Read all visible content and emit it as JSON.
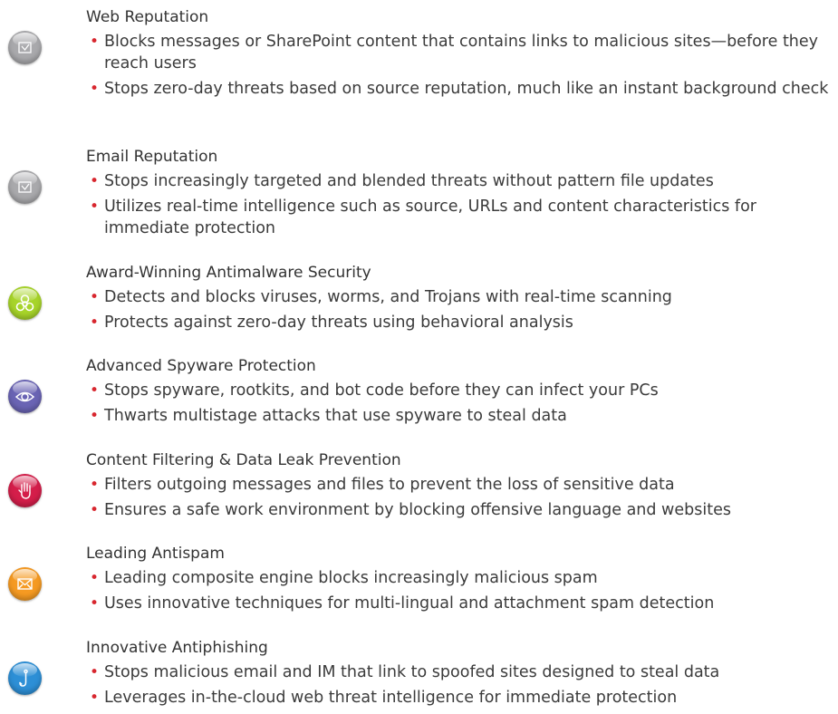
{
  "features": [
    {
      "title": "Web Reputation",
      "icon": "envelope-check-icon",
      "color": "#a9a9ac",
      "bullets": [
        "Blocks messages or SharePoint content that contains links to malicious sites—before they reach users",
        "Stops zero-day threats based on source reputation, much like an instant background check"
      ]
    },
    {
      "title": "Email Reputation",
      "icon": "envelope-check-icon",
      "color": "#a9a9ac",
      "bullets": [
        "Stops increasingly targeted and blended threats without pattern file updates",
        "Utilizes real-time intelligence such as source, URLs and content characteristics for immediate protection"
      ]
    },
    {
      "title": "Award-Winning Antimalware Security",
      "icon": "biohazard-icon",
      "color": "#a7d42a",
      "bullets": [
        "Detects and blocks viruses, worms, and Trojans with real-time scanning",
        "Protects against zero-day threats using behavioral analysis"
      ]
    },
    {
      "title": "Advanced Spyware Protection",
      "icon": "eye-icon",
      "color": "#6a64b4",
      "bullets": [
        "Stops spyware, rootkits, and bot code before they can infect your PCs",
        "Thwarts multistage attacks that use spyware to steal data"
      ]
    },
    {
      "title": "Content Filtering & Data Leak Prevention",
      "icon": "hand-stop-icon",
      "color": "#d41e4a",
      "bullets": [
        "Filters outgoing messages and files to prevent the loss of sensitive data",
        "Ensures a safe work environment by blocking offensive language and websites"
      ]
    },
    {
      "title": "Leading Antispam",
      "icon": "envelope-icon",
      "color": "#f59a22",
      "bullets": [
        "Leading composite engine blocks increasingly malicious spam",
        "Uses innovative techniques for multi-lingual and attachment spam detection"
      ]
    },
    {
      "title": "Innovative Antiphishing",
      "icon": "fishhook-icon",
      "color": "#2d8fd6",
      "bullets": [
        "Stops malicious email and IM that link to spoofed sites designed to steal data",
        "Leverages in-the-cloud web threat intelligence for immediate protection"
      ]
    }
  ]
}
